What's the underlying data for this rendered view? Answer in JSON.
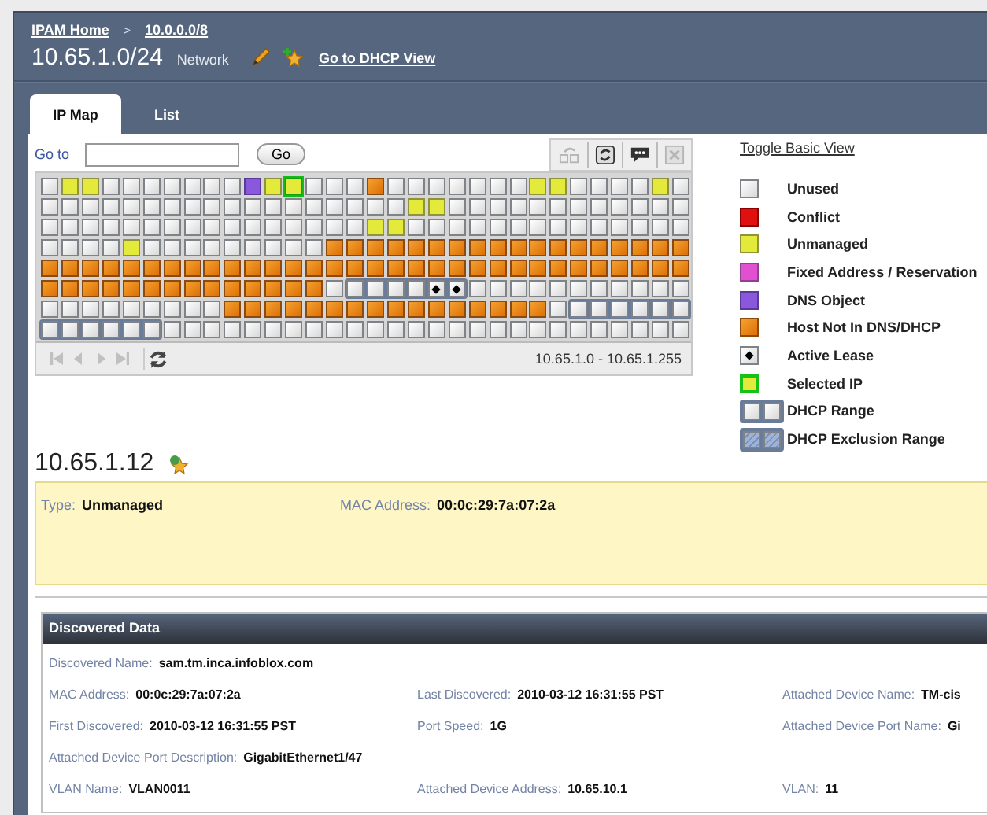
{
  "breadcrumbs": [
    {
      "label": "IPAM Home"
    },
    {
      "label": "10.0.0.0/8"
    }
  ],
  "breadcrumb_separator": ">",
  "network": {
    "title": "10.65.1.0/24",
    "type": "Network",
    "link": "Go to DHCP View"
  },
  "tabs": [
    {
      "label": "IP Map",
      "selected": true
    },
    {
      "label": "List",
      "selected": false
    }
  ],
  "goto": {
    "label": "Go to",
    "button": "Go"
  },
  "toolbar": [
    {
      "kind": "link",
      "disabled": true
    },
    {
      "kind": "refresh",
      "disabled": false
    },
    {
      "kind": "comment",
      "disabled": false
    },
    {
      "kind": "delete",
      "disabled": true
    }
  ],
  "ip_map": {
    "rows": [
      [
        {
          "kind": "unused"
        },
        {
          "kind": "unmanaged"
        },
        {
          "kind": "unmanaged"
        },
        {
          "kind": "unused"
        },
        {
          "kind": "unused"
        },
        {
          "kind": "unused"
        },
        {
          "kind": "unused"
        },
        {
          "kind": "unused"
        },
        {
          "kind": "unused"
        },
        {
          "kind": "unused"
        },
        {
          "kind": "dns"
        },
        {
          "kind": "unmanaged"
        },
        {
          "kind": "selected"
        },
        {
          "kind": "unused"
        },
        {
          "kind": "unused"
        },
        {
          "kind": "unused"
        },
        {
          "kind": "host"
        },
        {
          "kind": "unused"
        },
        {
          "kind": "unused"
        },
        {
          "kind": "unused"
        },
        {
          "kind": "unused"
        },
        {
          "kind": "unused"
        },
        {
          "kind": "unused"
        },
        {
          "kind": "unused"
        },
        {
          "kind": "unmanaged"
        },
        {
          "kind": "unmanaged"
        },
        {
          "kind": "unused"
        },
        {
          "kind": "unused"
        },
        {
          "kind": "unused"
        },
        {
          "kind": "unused"
        },
        {
          "kind": "unmanaged"
        },
        {
          "kind": "unused"
        }
      ],
      [
        {
          "kind": "unused"
        },
        {
          "kind": "unused"
        },
        {
          "kind": "unused"
        },
        {
          "kind": "unused"
        },
        {
          "kind": "unused"
        },
        {
          "kind": "unused"
        },
        {
          "kind": "unused"
        },
        {
          "kind": "unused"
        },
        {
          "kind": "unused"
        },
        {
          "kind": "unused"
        },
        {
          "kind": "unused"
        },
        {
          "kind": "unused"
        },
        {
          "kind": "unused"
        },
        {
          "kind": "unused"
        },
        {
          "kind": "unused"
        },
        {
          "kind": "unused"
        },
        {
          "kind": "unused"
        },
        {
          "kind": "unused"
        },
        {
          "kind": "unmanaged"
        },
        {
          "kind": "unmanaged"
        },
        {
          "kind": "unused"
        },
        {
          "kind": "unused"
        },
        {
          "kind": "unused"
        },
        {
          "kind": "unused"
        },
        {
          "kind": "unused"
        },
        {
          "kind": "unused"
        },
        {
          "kind": "unused"
        },
        {
          "kind": "unused"
        },
        {
          "kind": "unused"
        },
        {
          "kind": "unused"
        },
        {
          "kind": "unused"
        },
        {
          "kind": "unused"
        }
      ],
      [
        {
          "kind": "unused"
        },
        {
          "kind": "unused"
        },
        {
          "kind": "unused"
        },
        {
          "kind": "unused"
        },
        {
          "kind": "unused"
        },
        {
          "kind": "unused"
        },
        {
          "kind": "unused"
        },
        {
          "kind": "unused"
        },
        {
          "kind": "unused"
        },
        {
          "kind": "unused"
        },
        {
          "kind": "unused"
        },
        {
          "kind": "unused"
        },
        {
          "kind": "unused"
        },
        {
          "kind": "unused"
        },
        {
          "kind": "unused"
        },
        {
          "kind": "unused"
        },
        {
          "kind": "unmanaged"
        },
        {
          "kind": "unmanaged"
        },
        {
          "kind": "unused"
        },
        {
          "kind": "unused"
        },
        {
          "kind": "unused"
        },
        {
          "kind": "unused"
        },
        {
          "kind": "unused"
        },
        {
          "kind": "unused"
        },
        {
          "kind": "unused"
        },
        {
          "kind": "unused"
        },
        {
          "kind": "unused"
        },
        {
          "kind": "unused"
        },
        {
          "kind": "unused"
        },
        {
          "kind": "unused"
        },
        {
          "kind": "unused"
        },
        {
          "kind": "unused"
        }
      ],
      [
        {
          "kind": "unused"
        },
        {
          "kind": "unused"
        },
        {
          "kind": "unused"
        },
        {
          "kind": "unused"
        },
        {
          "kind": "unmanaged"
        },
        {
          "kind": "unused"
        },
        {
          "kind": "unused"
        },
        {
          "kind": "unused"
        },
        {
          "kind": "unused"
        },
        {
          "kind": "unused"
        },
        {
          "kind": "unused"
        },
        {
          "kind": "unused"
        },
        {
          "kind": "unused"
        },
        {
          "kind": "unused"
        },
        {
          "kind": "host"
        },
        {
          "kind": "host"
        },
        {
          "kind": "host"
        },
        {
          "kind": "host"
        },
        {
          "kind": "host"
        },
        {
          "kind": "host"
        },
        {
          "kind": "host"
        },
        {
          "kind": "host"
        },
        {
          "kind": "host"
        },
        {
          "kind": "host"
        },
        {
          "kind": "host"
        },
        {
          "kind": "host"
        },
        {
          "kind": "host"
        },
        {
          "kind": "host"
        },
        {
          "kind": "host"
        },
        {
          "kind": "host"
        },
        {
          "kind": "host"
        },
        {
          "kind": "host"
        }
      ],
      [
        {
          "kind": "host"
        },
        {
          "kind": "host"
        },
        {
          "kind": "host"
        },
        {
          "kind": "host"
        },
        {
          "kind": "host"
        },
        {
          "kind": "host"
        },
        {
          "kind": "host"
        },
        {
          "kind": "host"
        },
        {
          "kind": "host"
        },
        {
          "kind": "host"
        },
        {
          "kind": "host"
        },
        {
          "kind": "host"
        },
        {
          "kind": "host"
        },
        {
          "kind": "host"
        },
        {
          "kind": "host"
        },
        {
          "kind": "host"
        },
        {
          "kind": "host"
        },
        {
          "kind": "host"
        },
        {
          "kind": "host"
        },
        {
          "kind": "host"
        },
        {
          "kind": "host"
        },
        {
          "kind": "host"
        },
        {
          "kind": "host"
        },
        {
          "kind": "host"
        },
        {
          "kind": "host"
        },
        {
          "kind": "host"
        },
        {
          "kind": "host"
        },
        {
          "kind": "host"
        },
        {
          "kind": "host"
        },
        {
          "kind": "host"
        },
        {
          "kind": "host"
        },
        {
          "kind": "host"
        }
      ],
      [
        {
          "kind": "host"
        },
        {
          "kind": "host"
        },
        {
          "kind": "host"
        },
        {
          "kind": "host"
        },
        {
          "kind": "host"
        },
        {
          "kind": "host"
        },
        {
          "kind": "host"
        },
        {
          "kind": "host"
        },
        {
          "kind": "host"
        },
        {
          "kind": "host"
        },
        {
          "kind": "host"
        },
        {
          "kind": "host"
        },
        {
          "kind": "host"
        },
        {
          "kind": "host"
        },
        {
          "kind": "unused"
        },
        {
          "kind": "range"
        },
        {
          "kind": "range"
        },
        {
          "kind": "range"
        },
        {
          "kind": "range"
        },
        {
          "kind": "lease"
        },
        {
          "kind": "lease"
        },
        {
          "kind": "unused"
        },
        {
          "kind": "unused"
        },
        {
          "kind": "unused"
        },
        {
          "kind": "unused"
        },
        {
          "kind": "unused"
        },
        {
          "kind": "unused"
        },
        {
          "kind": "unused"
        },
        {
          "kind": "unused"
        },
        {
          "kind": "unused"
        },
        {
          "kind": "unused"
        },
        {
          "kind": "unused"
        }
      ],
      [
        {
          "kind": "unused"
        },
        {
          "kind": "unused"
        },
        {
          "kind": "unused"
        },
        {
          "kind": "unused"
        },
        {
          "kind": "unused"
        },
        {
          "kind": "unused"
        },
        {
          "kind": "unused"
        },
        {
          "kind": "unused"
        },
        {
          "kind": "unused"
        },
        {
          "kind": "host"
        },
        {
          "kind": "host"
        },
        {
          "kind": "host"
        },
        {
          "kind": "host"
        },
        {
          "kind": "host"
        },
        {
          "kind": "host"
        },
        {
          "kind": "host"
        },
        {
          "kind": "host"
        },
        {
          "kind": "host"
        },
        {
          "kind": "host"
        },
        {
          "kind": "host"
        },
        {
          "kind": "host"
        },
        {
          "kind": "host"
        },
        {
          "kind": "host"
        },
        {
          "kind": "host"
        },
        {
          "kind": "host"
        },
        {
          "kind": "unused"
        },
        {
          "kind": "range"
        },
        {
          "kind": "range"
        },
        {
          "kind": "range"
        },
        {
          "kind": "range"
        },
        {
          "kind": "range"
        },
        {
          "kind": "range"
        }
      ],
      [
        {
          "kind": "range"
        },
        {
          "kind": "range"
        },
        {
          "kind": "range"
        },
        {
          "kind": "range"
        },
        {
          "kind": "range"
        },
        {
          "kind": "range"
        },
        {
          "kind": "unused"
        },
        {
          "kind": "unused"
        },
        {
          "kind": "unused"
        },
        {
          "kind": "unused"
        },
        {
          "kind": "unused"
        },
        {
          "kind": "unused"
        },
        {
          "kind": "unused"
        },
        {
          "kind": "unused"
        },
        {
          "kind": "unused"
        },
        {
          "kind": "unused"
        },
        {
          "kind": "unused"
        },
        {
          "kind": "unused"
        },
        {
          "kind": "unused"
        },
        {
          "kind": "unused"
        },
        {
          "kind": "unused"
        },
        {
          "kind": "unused"
        },
        {
          "kind": "unused"
        },
        {
          "kind": "unused"
        },
        {
          "kind": "unused"
        },
        {
          "kind": "unused"
        },
        {
          "kind": "unused"
        },
        {
          "kind": "unused"
        },
        {
          "kind": "unused"
        },
        {
          "kind": "unused"
        },
        {
          "kind": "unused"
        },
        {
          "kind": "unused"
        }
      ]
    ],
    "pager": [
      {
        "kind": "first",
        "disabled": true
      },
      {
        "kind": "previous",
        "disabled": true
      },
      {
        "kind": "next",
        "disabled": true
      },
      {
        "kind": "last",
        "disabled": true
      },
      {
        "kind": "refresh",
        "disabled": false
      }
    ],
    "range": "10.65.1.0 - 10.65.1.255"
  },
  "legend": {
    "toggle": "Toggle Basic View",
    "items": [
      {
        "kind": "unused",
        "label": "Unused"
      },
      {
        "kind": "conflict",
        "label": "Conflict"
      },
      {
        "kind": "unmanaged",
        "label": "Unmanaged"
      },
      {
        "kind": "fixed",
        "label": "Fixed Address / Reservation"
      },
      {
        "kind": "dns",
        "label": "DNS Object"
      },
      {
        "kind": "host",
        "label": "Host Not In DNS/DHCP"
      },
      {
        "kind": "lease",
        "label": "Active Lease"
      },
      {
        "kind": "selected",
        "label": "Selected IP"
      },
      {
        "kind": "range",
        "label": "DHCP Range"
      },
      {
        "kind": "exclusion",
        "label": "DHCP Exclusion Range"
      }
    ]
  },
  "selected_ip": {
    "address": "10.65.1.12",
    "fields": [
      {
        "label": "Type:",
        "value": "Unmanaged"
      },
      {
        "label": "MAC Address:",
        "value": "00:0c:29:7a:07:2a"
      }
    ]
  },
  "discovered": {
    "title": "Discovered Data",
    "rows": [
      [
        {
          "label": "Discovered Name:",
          "value": "sam.tm.inca.infoblox.com"
        }
      ],
      [
        {
          "label": "MAC Address:",
          "value": "00:0c:29:7a:07:2a"
        },
        {
          "label": "Last Discovered:",
          "value": "2010-03-12 16:31:55 PST"
        },
        {
          "label": "Attached Device Name:",
          "value": "TM-cis"
        }
      ],
      [
        {
          "label": "First Discovered:",
          "value": "2010-03-12 16:31:55 PST"
        },
        {
          "label": "Port Speed:",
          "value": "1G"
        },
        {
          "label": "Attached Device Port Name:",
          "value": "Gi"
        }
      ],
      [
        {
          "label": "Attached Device Port Description:",
          "value": "GigabitEthernet1/47"
        }
      ],
      [
        {
          "label": "VLAN Name:",
          "value": "VLAN0011"
        },
        {
          "label": "Attached Device Address:",
          "value": "10.65.10.1"
        },
        {
          "label": "VLAN:",
          "value": "11"
        }
      ]
    ]
  }
}
